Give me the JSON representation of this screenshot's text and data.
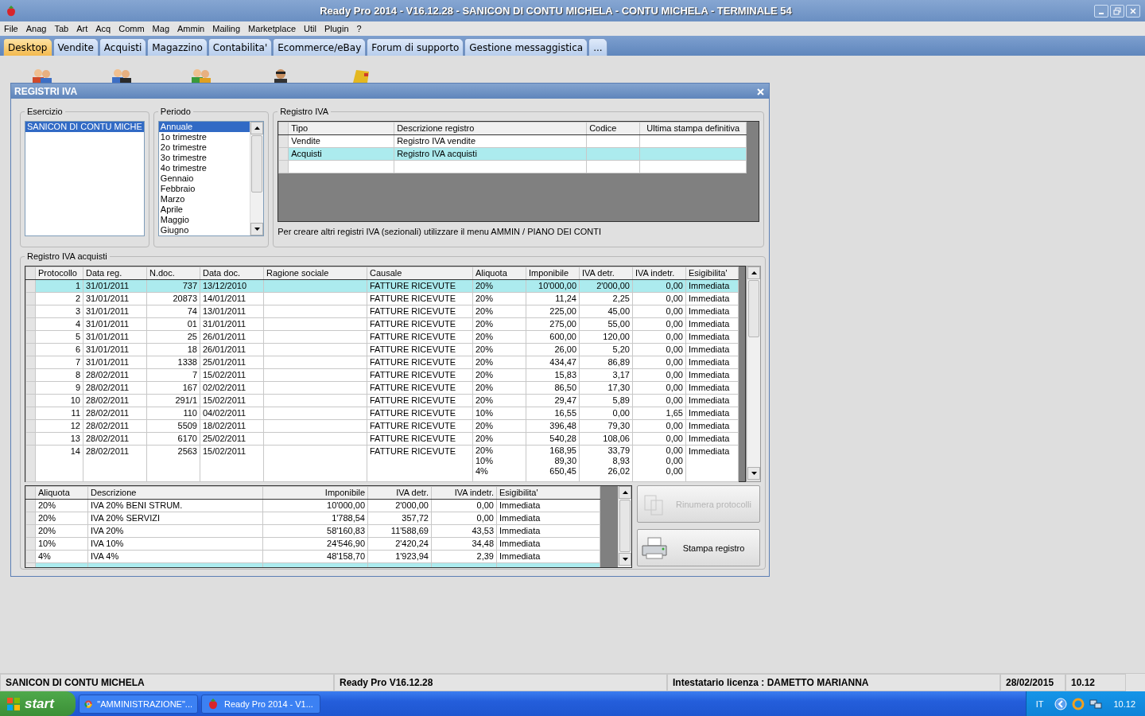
{
  "window": {
    "title": "Ready Pro 2014 - V16.12.28 - SANICON DI CONTU MICHELA - CONTU MICHELA - TERMINALE 54"
  },
  "menu": [
    "File",
    "Anag",
    "Tab",
    "Art",
    "Acq",
    "Comm",
    "Mag",
    "Ammin",
    "Mailing",
    "Marketplace",
    "Util",
    "Plugin",
    "?"
  ],
  "tabs": [
    {
      "label": "Desktop",
      "selected": true
    },
    {
      "label": "Vendite",
      "selected": false
    },
    {
      "label": "Acquisti",
      "selected": false
    },
    {
      "label": "Magazzino",
      "selected": false
    },
    {
      "label": "Contabilita'",
      "selected": false
    },
    {
      "label": "Ecommerce/eBay",
      "selected": false
    },
    {
      "label": "Forum di supporto",
      "selected": false
    },
    {
      "label": "Gestione messaggistica",
      "selected": false
    },
    {
      "label": "...",
      "selected": false
    }
  ],
  "dialog": {
    "title": "REGISTRI IVA",
    "esercizio": {
      "label": "Esercizio",
      "items": [
        {
          "label": "SANICON DI CONTU MICHE",
          "selected": true
        }
      ]
    },
    "periodo": {
      "label": "Periodo",
      "items": [
        {
          "label": "Annuale",
          "selected": true
        },
        {
          "label": "1o trimestre",
          "selected": false
        },
        {
          "label": "2o trimestre",
          "selected": false
        },
        {
          "label": "3o trimestre",
          "selected": false
        },
        {
          "label": "4o trimestre",
          "selected": false
        },
        {
          "label": "Gennaio",
          "selected": false
        },
        {
          "label": "Febbraio",
          "selected": false
        },
        {
          "label": "Marzo",
          "selected": false
        },
        {
          "label": "Aprile",
          "selected": false
        },
        {
          "label": "Maggio",
          "selected": false
        },
        {
          "label": "Giugno",
          "selected": false
        }
      ]
    },
    "registro": {
      "label": "Registro IVA",
      "columns": [
        "Tipo",
        "Descrizione registro",
        "Codice",
        "Ultima stampa definitiva"
      ],
      "rows": [
        {
          "selected": false,
          "cells": [
            "Vendite",
            "Registro IVA vendite"
          ]
        },
        {
          "selected": true,
          "cells": [
            "Acquisti",
            "Registro IVA acquisti"
          ]
        },
        {
          "selected": false,
          "cells": []
        }
      ],
      "note": "Per creare altri registri IVA (sezionali) utilizzare il menu AMMIN / PIANO DEI CONTI"
    },
    "acquisti": {
      "label": "Registro IVA acquisti",
      "columns": [
        "Protocollo",
        "Data reg.",
        "N.doc.",
        "Data doc.",
        "Ragione sociale",
        "Causale",
        "Aliquota",
        "Imponibile",
        "IVA detr.",
        "IVA indetr.",
        "Esigibilita'"
      ],
      "rows": [
        {
          "selected": true,
          "cells": [
            "1",
            "31/01/2011",
            "737",
            "13/12/2010",
            "",
            "FATTURE RICEVUTE",
            "20%",
            "10'000,00",
            "2'000,00",
            "0,00",
            "Immediata"
          ]
        },
        {
          "selected": false,
          "cells": [
            "2",
            "31/01/2011",
            "20873",
            "14/01/2011",
            "",
            "FATTURE RICEVUTE",
            "20%",
            "11,24",
            "2,25",
            "0,00",
            "Immediata"
          ]
        },
        {
          "selected": false,
          "cells": [
            "3",
            "31/01/2011",
            "74",
            "13/01/2011",
            "",
            "FATTURE RICEVUTE",
            "20%",
            "225,00",
            "45,00",
            "0,00",
            "Immediata"
          ]
        },
        {
          "selected": false,
          "cells": [
            "4",
            "31/01/2011",
            "01",
            "31/01/2011",
            "",
            "FATTURE RICEVUTE",
            "20%",
            "275,00",
            "55,00",
            "0,00",
            "Immediata"
          ]
        },
        {
          "selected": false,
          "cells": [
            "5",
            "31/01/2011",
            "25",
            "26/01/2011",
            "",
            "FATTURE RICEVUTE",
            "20%",
            "600,00",
            "120,00",
            "0,00",
            "Immediata"
          ]
        },
        {
          "selected": false,
          "cells": [
            "6",
            "31/01/2011",
            "18",
            "26/01/2011",
            "",
            "FATTURE RICEVUTE",
            "20%",
            "26,00",
            "5,20",
            "0,00",
            "Immediata"
          ]
        },
        {
          "selected": false,
          "cells": [
            "7",
            "31/01/2011",
            "1338",
            "25/01/2011",
            "",
            "FATTURE RICEVUTE",
            "20%",
            "434,47",
            "86,89",
            "0,00",
            "Immediata"
          ]
        },
        {
          "selected": false,
          "cells": [
            "8",
            "28/02/2011",
            "7",
            "15/02/2011",
            "",
            "FATTURE RICEVUTE",
            "20%",
            "15,83",
            "3,17",
            "0,00",
            "Immediata"
          ]
        },
        {
          "selected": false,
          "cells": [
            "9",
            "28/02/2011",
            "167",
            "02/02/2011",
            "",
            "FATTURE RICEVUTE",
            "20%",
            "86,50",
            "17,30",
            "0,00",
            "Immediata"
          ]
        },
        {
          "selected": false,
          "cells": [
            "10",
            "28/02/2011",
            "291/1",
            "15/02/2011",
            "",
            "FATTURE RICEVUTE",
            "20%",
            "29,47",
            "5,89",
            "0,00",
            "Immediata"
          ]
        },
        {
          "selected": false,
          "cells": [
            "11",
            "28/02/2011",
            "110",
            "04/02/2011",
            "",
            "FATTURE RICEVUTE",
            "10%",
            "16,55",
            "0,00",
            "1,65",
            "Immediata"
          ]
        },
        {
          "selected": false,
          "cells": [
            "12",
            "28/02/2011",
            "5509",
            "18/02/2011",
            "",
            "FATTURE RICEVUTE",
            "20%",
            "396,48",
            "79,30",
            "0,00",
            "Immediata"
          ]
        },
        {
          "selected": false,
          "cells": [
            "13",
            "28/02/2011",
            "6170",
            "25/02/2011",
            "",
            "FATTURE RICEVUTE",
            "20%",
            "540,28",
            "108,06",
            "0,00",
            "Immediata"
          ]
        },
        {
          "selected": false,
          "cells": [
            "14",
            "28/02/2011",
            "2563",
            "15/02/2011",
            "",
            "FATTURE RICEVUTE",
            [
              "20%",
              "10%",
              "4%"
            ],
            [
              "168,95",
              "89,30",
              "650,45"
            ],
            [
              "33,79",
              "8,93",
              "26,02"
            ],
            [
              "0,00",
              "0,00",
              "0,00"
            ],
            "Immediata"
          ]
        }
      ]
    },
    "riepilogo": {
      "columns": [
        "Aliquota",
        "Descrizione",
        "Imponibile",
        "IVA detr.",
        "IVA indetr.",
        "Esigibilita'"
      ],
      "rows": [
        {
          "selected": false,
          "cells": [
            "20%",
            "IVA 20% BENI STRUM.",
            "10'000,00",
            "2'000,00",
            "0,00",
            "Immediata"
          ]
        },
        {
          "selected": false,
          "cells": [
            "20%",
            "IVA 20% SERVIZI",
            "1'788,54",
            "357,72",
            "0,00",
            "Immediata"
          ]
        },
        {
          "selected": false,
          "cells": [
            "20%",
            "IVA 20%",
            "58'160,83",
            "11'588,69",
            "43,53",
            "Immediata"
          ]
        },
        {
          "selected": false,
          "cells": [
            "10%",
            "IVA 10%",
            "24'546,90",
            "2'420,24",
            "34,48",
            "Immediata"
          ]
        },
        {
          "selected": false,
          "cells": [
            "4%",
            "IVA 4%",
            "48'158,70",
            "1'923,94",
            "2,39",
            "Immediata"
          ]
        },
        {
          "selected": true,
          "cells": []
        }
      ]
    },
    "buttons": [
      {
        "label": "Rinumera protocolli",
        "kind": "renumber",
        "disabled": true
      },
      {
        "label": "Stampa registro",
        "kind": "print",
        "disabled": false
      }
    ]
  },
  "status_bar": [
    "SANICON DI CONTU MICHELA",
    "Ready Pro V16.12.28",
    "Intestatario licenza : DAMETTO MARIANNA",
    "28/02/2015",
    "10.12"
  ],
  "taskbar": {
    "start": "start",
    "tasks": [
      {
        "label": "\"AMMINISTRAZIONE\"...",
        "kind": "browser"
      },
      {
        "label": "Ready Pro 2014 - V1...",
        "kind": "app"
      }
    ],
    "language": "IT",
    "clock": "10.12"
  }
}
